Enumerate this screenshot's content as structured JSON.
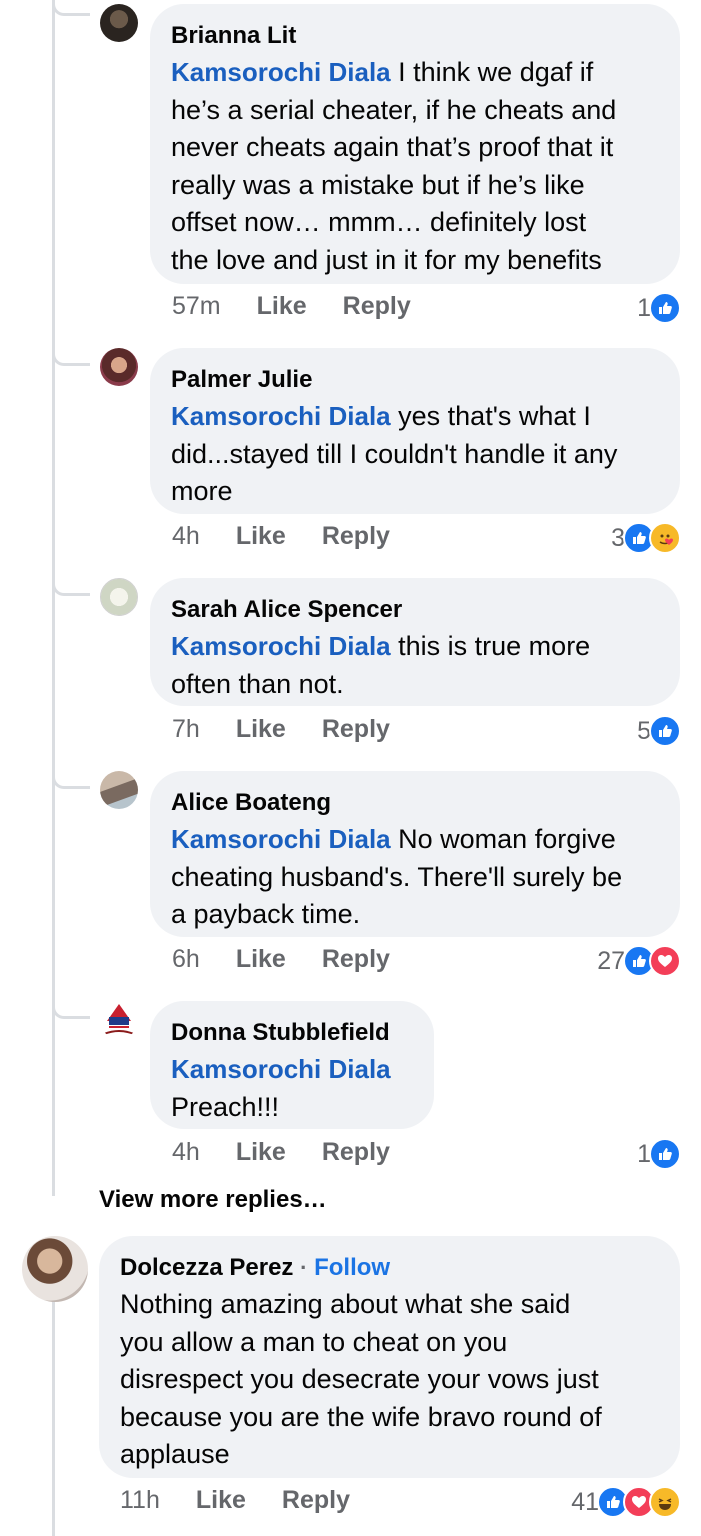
{
  "replies": [
    {
      "author": "Brianna Lit",
      "mention": "Kamsorochi Diala",
      "lines": [
        " I think we dgaf if",
        "he’s a serial cheater, if he cheats and",
        "never cheats again that’s proof that it",
        "really was a mistake but if he’s like",
        "offset now… mmm… definitely lost",
        "the love and just in it for my benefits"
      ],
      "time": "57m",
      "like_label": "Like",
      "reply_label": "Reply",
      "reaction_count": "1",
      "reactions": [
        "like"
      ]
    },
    {
      "author": "Palmer Julie",
      "mention": "Kamsorochi Diala",
      "lines": [
        " yes that's what I",
        "did...stayed till I couldn't handle it any",
        "more"
      ],
      "time": "4h",
      "like_label": "Like",
      "reply_label": "Reply",
      "reaction_count": "3",
      "reactions": [
        "like",
        "care"
      ]
    },
    {
      "author": "Sarah Alice Spencer",
      "mention": "Kamsorochi Diala",
      "lines": [
        " this is true more",
        "often than not."
      ],
      "time": "7h",
      "like_label": "Like",
      "reply_label": "Reply",
      "reaction_count": "5",
      "reactions": [
        "like"
      ]
    },
    {
      "author": "Alice Boateng",
      "mention": "Kamsorochi Diala",
      "lines": [
        " No woman forgive",
        "cheating husband's. There'll surely be",
        "a payback time."
      ],
      "time": "6h",
      "like_label": "Like",
      "reply_label": "Reply",
      "reaction_count": "27",
      "reactions": [
        "like",
        "love"
      ]
    },
    {
      "author": "Donna Stubblefield",
      "mention": "Kamsorochi Diala",
      "lines": [
        "",
        "Preach!!!"
      ],
      "time": "4h",
      "like_label": "Like",
      "reply_label": "Reply",
      "reaction_count": "1",
      "reactions": [
        "like"
      ]
    }
  ],
  "view_more": "View more replies…",
  "top_comment": {
    "author": "Dolcezza Perez",
    "separator": "·",
    "follow_label": "Follow",
    "lines": [
      "Nothing amazing about what she said",
      "you allow a man to cheat on you",
      "disrespect you desecrate your vows just",
      "because you are the wife bravo round of",
      "applause"
    ],
    "time": "11h",
    "like_label": "Like",
    "reply_label": "Reply",
    "reaction_count": "41",
    "reactions": [
      "like",
      "love",
      "haha"
    ]
  },
  "colors": {
    "bubble": "#f0f2f5",
    "mention": "#1a5fbf",
    "meta": "#65676b",
    "like": "#1877f2",
    "love": "#f33e58",
    "haha": "#f7b928"
  }
}
